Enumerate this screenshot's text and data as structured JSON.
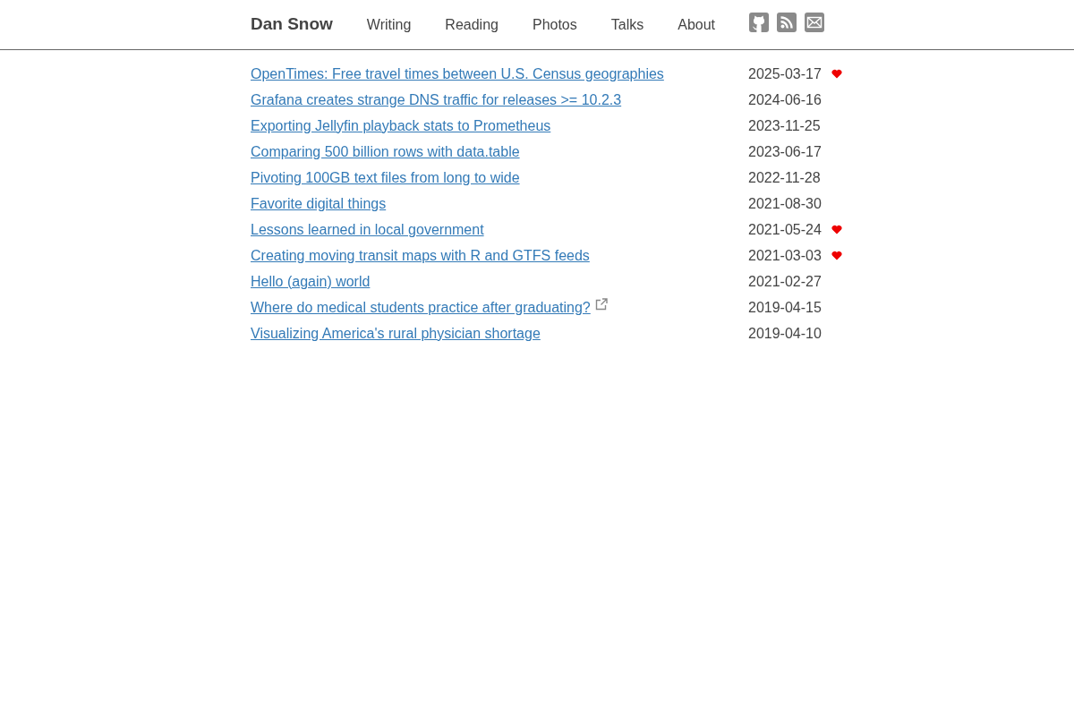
{
  "header": {
    "site_title": "Dan Snow",
    "nav": [
      {
        "label": "Writing"
      },
      {
        "label": "Reading"
      },
      {
        "label": "Photos"
      },
      {
        "label": "Talks"
      },
      {
        "label": "About"
      }
    ]
  },
  "posts": [
    {
      "title": "OpenTimes: Free travel times between U.S. Census geographies",
      "date": "2025-03-17",
      "favorite": true,
      "external": false
    },
    {
      "title": "Grafana creates strange DNS traffic for releases >= 10.2.3",
      "date": "2024-06-16",
      "favorite": false,
      "external": false
    },
    {
      "title": "Exporting Jellyfin playback stats to Prometheus",
      "date": "2023-11-25",
      "favorite": false,
      "external": false
    },
    {
      "title": "Comparing 500 billion rows with data.table",
      "date": "2023-06-17",
      "favorite": false,
      "external": false
    },
    {
      "title": "Pivoting 100GB text files from long to wide",
      "date": "2022-11-28",
      "favorite": false,
      "external": false
    },
    {
      "title": "Favorite digital things",
      "date": "2021-08-30",
      "favorite": false,
      "external": false
    },
    {
      "title": "Lessons learned in local government",
      "date": "2021-05-24",
      "favorite": true,
      "external": false
    },
    {
      "title": "Creating moving transit maps with R and GTFS feeds",
      "date": "2021-03-03",
      "favorite": true,
      "external": false
    },
    {
      "title": "Hello (again) world",
      "date": "2021-02-27",
      "favorite": false,
      "external": false
    },
    {
      "title": "Where do medical students practice after graduating?",
      "date": "2019-04-15",
      "favorite": false,
      "external": true
    },
    {
      "title": "Visualizing America's rural physician shortage",
      "date": "2019-04-10",
      "favorite": false,
      "external": false
    }
  ]
}
